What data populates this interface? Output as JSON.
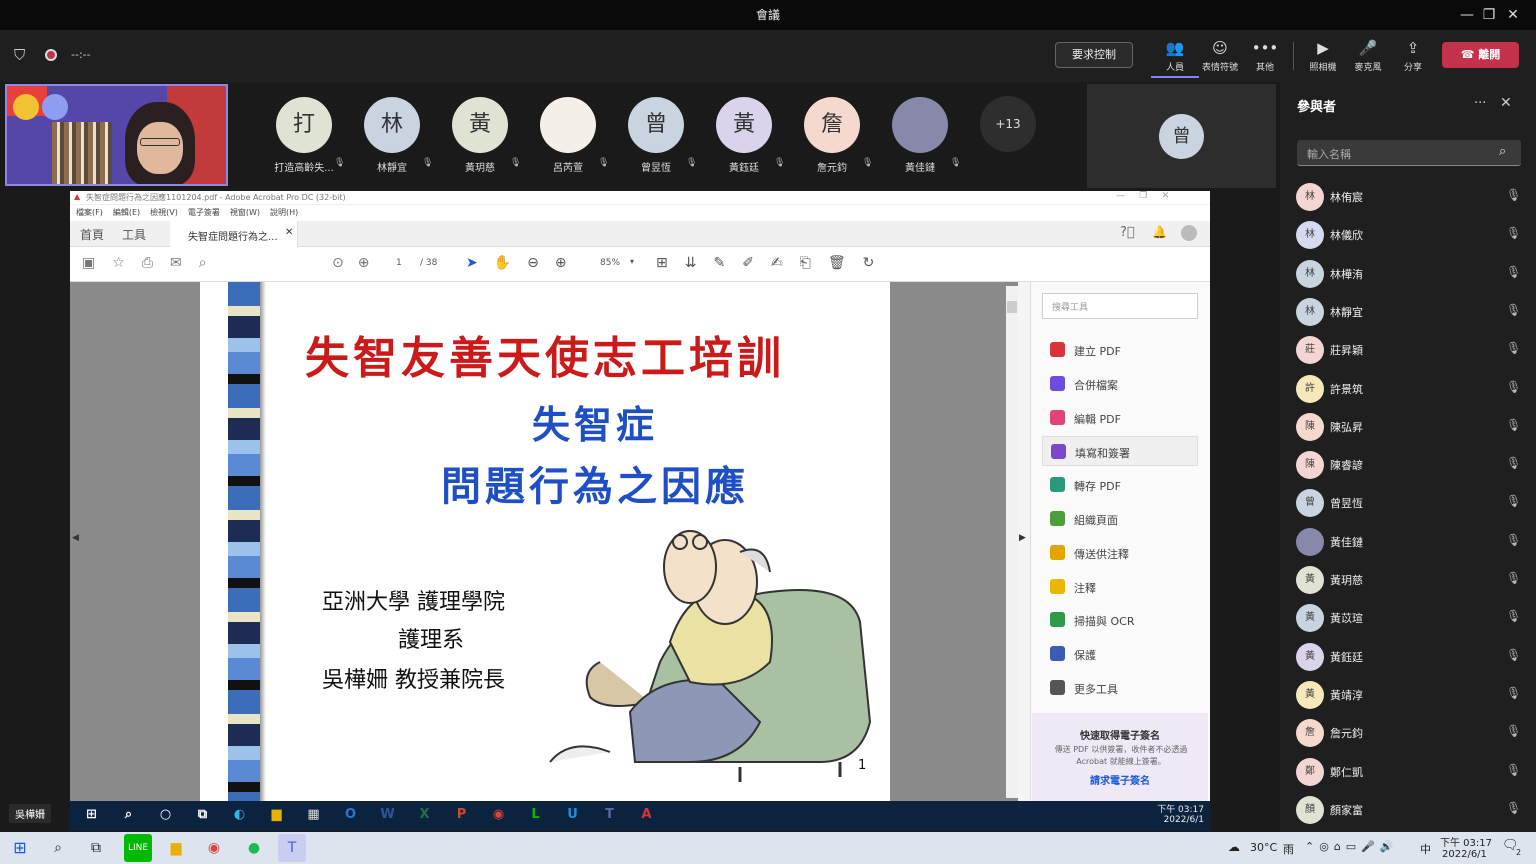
{
  "window": {
    "title": "會議",
    "minimize": "—",
    "restore": "❐",
    "close": "✕"
  },
  "meeting": {
    "timer": "--:--",
    "request_control": "要求控制",
    "toolbar": [
      {
        "label": "人員",
        "icon": "people-icon"
      },
      {
        "label": "表情符號",
        "icon": "emoji-icon"
      },
      {
        "label": "其他",
        "icon": "more-icon"
      },
      {
        "label": "照相機",
        "icon": "camera-off-icon"
      },
      {
        "label": "麥克風",
        "icon": "mic-off-icon"
      },
      {
        "label": "分享",
        "icon": "share-icon"
      }
    ],
    "leave": "離開"
  },
  "gallery": [
    {
      "initial": "打",
      "name": "打造高齡失...",
      "color": "#dfe3d3"
    },
    {
      "initial": "林",
      "name": "林靜宜",
      "color": "#c9d4e0"
    },
    {
      "initial": "黃",
      "name": "黃玥慈",
      "color": "#dfe3d3"
    },
    {
      "initial": "",
      "name": "呂芮萱",
      "color": "#f4efe9"
    },
    {
      "initial": "曾",
      "name": "曾昱恆",
      "color": "#c9d4e0"
    },
    {
      "initial": "黃",
      "name": "黃鈺廷",
      "color": "#d9d3ec"
    },
    {
      "initial": "詹",
      "name": "詹元鈞",
      "color": "#f5d9cf"
    },
    {
      "initial": "",
      "name": "黃佳鏈",
      "color": "#88a"
    }
  ],
  "overflow_count": "+13",
  "spotlight_initial": "曾",
  "panel": {
    "title": "參與者",
    "search_placeholder": "輸入名稱",
    "participants": [
      {
        "initial": "林",
        "name": "林侑宸",
        "color": "#f3d6d3"
      },
      {
        "initial": "林",
        "name": "林儀欣",
        "color": "#d6daf0"
      },
      {
        "initial": "林",
        "name": "林樺洧",
        "color": "#c9d4e0"
      },
      {
        "initial": "林",
        "name": "林靜宜",
        "color": "#c9d4e0"
      },
      {
        "initial": "莊",
        "name": "莊昇穎",
        "color": "#f3d6d3"
      },
      {
        "initial": "許",
        "name": "許景筑",
        "color": "#f6e8b8"
      },
      {
        "initial": "陳",
        "name": "陳弘昇",
        "color": "#f5d9cf"
      },
      {
        "initial": "陳",
        "name": "陳睿諺",
        "color": "#f3d6d3"
      },
      {
        "initial": "曾",
        "name": "曾昱恆",
        "color": "#c9d4e0"
      },
      {
        "initial": "",
        "name": "黃佳鏈",
        "color": "#88a"
      },
      {
        "initial": "黃",
        "name": "黃玥慈",
        "color": "#dfe3d3"
      },
      {
        "initial": "黃",
        "name": "黃苡瑄",
        "color": "#c9d4e0"
      },
      {
        "initial": "黃",
        "name": "黃鈺廷",
        "color": "#d9d3ec"
      },
      {
        "initial": "黃",
        "name": "黃靖淳",
        "color": "#f6e8b8"
      },
      {
        "initial": "詹",
        "name": "詹元鈞",
        "color": "#f5d9cf"
      },
      {
        "initial": "鄭",
        "name": "鄭仁凱",
        "color": "#f3d6d3"
      },
      {
        "initial": "顏",
        "name": "顏家富",
        "color": "#dfe3d3"
      }
    ]
  },
  "acrobat": {
    "title": "失智症問題行為之因應1101204.pdf - Adobe Acrobat Pro DC (32-bit)",
    "menu": [
      "檔案(F)",
      "編輯(E)",
      "檢視(V)",
      "電子簽署",
      "視窗(W)",
      "說明(H)"
    ],
    "tabs": [
      "首頁",
      "工具"
    ],
    "doc_tab": "失智症問題行為之...",
    "page_current": "1",
    "page_total": "/ 38",
    "zoom": "85%",
    "tool_search": "搜尋工具",
    "tools": [
      {
        "label": "建立 PDF",
        "color": "#d8333a"
      },
      {
        "label": "合併檔案",
        "color": "#6f4be0"
      },
      {
        "label": "編輯 PDF",
        "color": "#e0427a"
      },
      {
        "label": "填寫和簽署",
        "color": "#7a48c9"
      },
      {
        "label": "轉存 PDF",
        "color": "#2a9a7e"
      },
      {
        "label": "組織頁面",
        "color": "#4e9d3a"
      },
      {
        "label": "傳送供注釋",
        "color": "#e4a400"
      },
      {
        "label": "注釋",
        "color": "#e9b600"
      },
      {
        "label": "掃描與 OCR",
        "color": "#2e9a4a"
      },
      {
        "label": "保護",
        "color": "#3c5bb5"
      },
      {
        "label": "更多工具",
        "color": "#555"
      }
    ],
    "promo_title": "快速取得電子簽名",
    "promo_text": "傳送 PDF 以供簽署，收件者不必透過 Acrobat 就能線上簽署。",
    "promo_link": "請求電子簽名",
    "slide": {
      "title": "失智友善天使志工培訓",
      "subtitle1": "失智症",
      "subtitle2": "問題行為之因應",
      "author1": "亞洲大學  護理學院",
      "author2": "護理系",
      "author3": "吳樺姍  教授兼院長",
      "page": "1"
    }
  },
  "presenter": "吳樺姍",
  "shared_clock": {
    "time": "下午 03:17",
    "date": "2022/6/1"
  },
  "system_tray": {
    "weather": "30°C",
    "rain": "雨",
    "ime": "中",
    "time": "下午 03:17",
    "date": "2022/6/1",
    "notif": "2"
  }
}
